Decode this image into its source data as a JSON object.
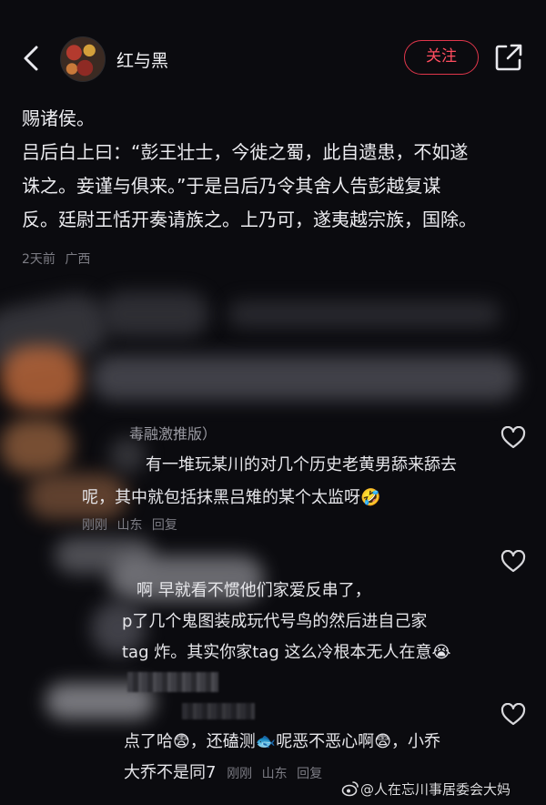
{
  "header": {
    "account_name": "红与黑",
    "follow_label": "关注"
  },
  "post": {
    "lines": [
      "赐诸侯。",
      "吕后白上曰：“彭王壮士，今徙之蜀，此自遗患，不如遂",
      "诛之。妾谨与俱来。”于是吕后乃令其舍人告彭越复谋",
      "反。廷尉王恬开奏请族之。上乃可，遂夷越宗族，国除。"
    ],
    "time": "2天前",
    "location": "广西"
  },
  "comments": [
    {
      "lines": [
        "毒融激推版）",
        "有一堆玩某川的对几个历史老黄男舔来舔去",
        "呢，其中就包括抹黑吕雉的某个太监呀"
      ],
      "emoji": "🤣",
      "time": "刚刚",
      "location": "山东",
      "reply_label": "回复"
    },
    {
      "lines": [
        "啊          早就看不惯他们家爱反串了，",
        "p了几个鬼图装成玩代号鸟的然后进自己家",
        "tag 炸。其实你家tag 这么冷根本无人在意"
      ],
      "emoji": "😭",
      "time": "",
      "location": "",
      "reply_label": ""
    },
    {
      "line1_a": "点了哈",
      "emoji_1": "😨",
      "line1_b": "，还磕测",
      "emoji_2": "🐟",
      "line1_c": "呢恶不恶心啊",
      "emoji_3": "😨",
      "line1_d": "，小乔",
      "line2": "大乔不是同7",
      "time": "刚刚",
      "location": "山东",
      "reply_label": "回复"
    }
  ],
  "watermark": "@人在忘川事居委会大妈",
  "colors": {
    "background": "#0b0b0f",
    "accent": "#ff4d5f",
    "text": "#ececf0",
    "meta": "#7c7c84"
  },
  "icons": [
    "chevron-left-icon",
    "share-icon",
    "heart-outline-icon",
    "weibo-logo-icon"
  ]
}
